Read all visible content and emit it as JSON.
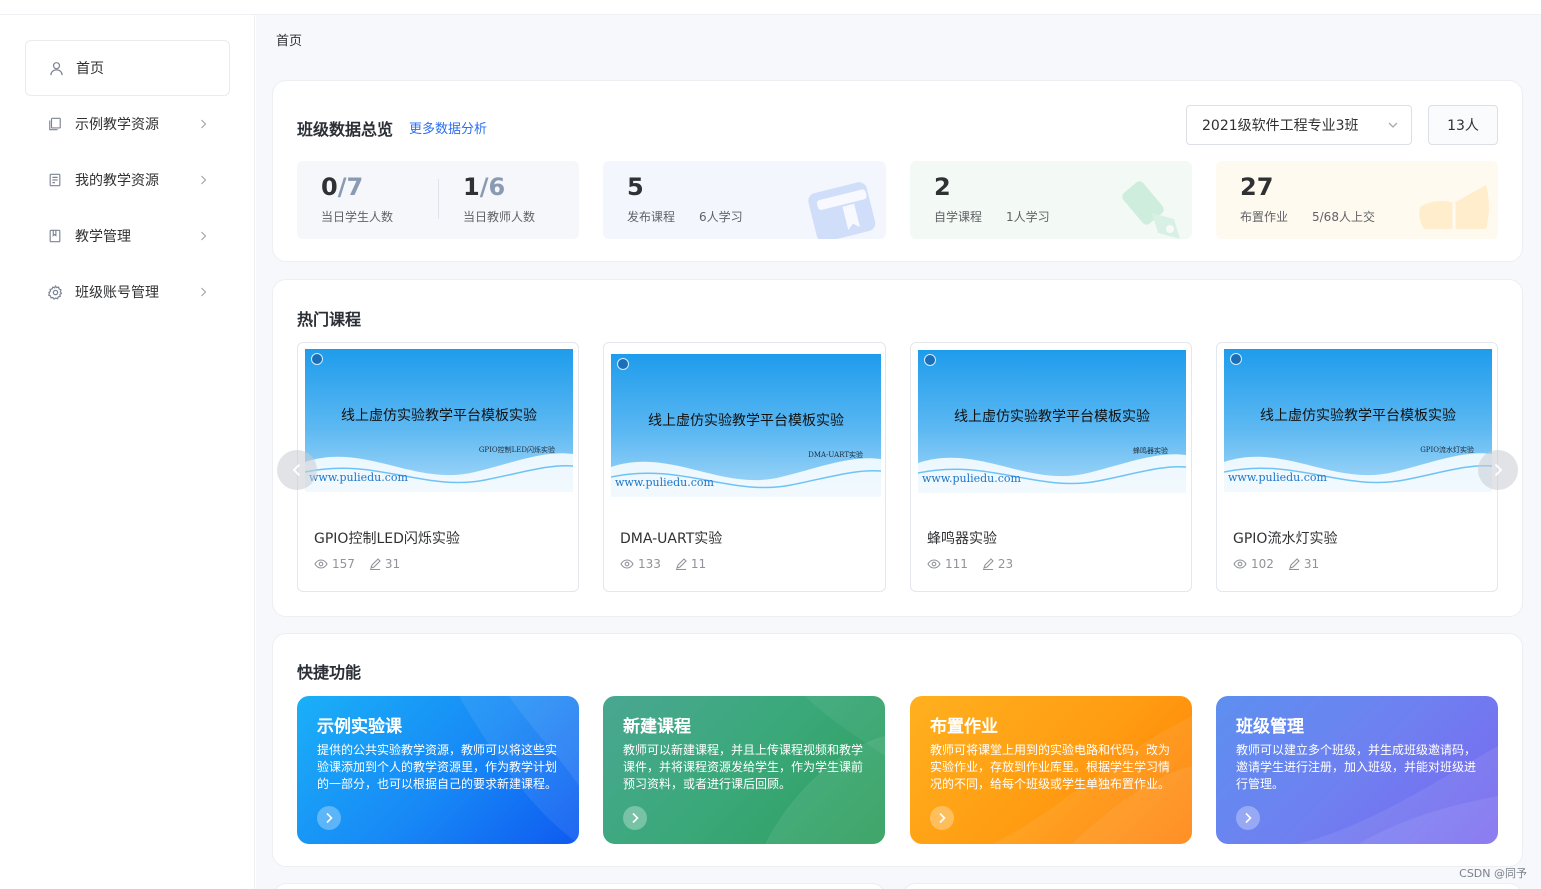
{
  "sidebar": {
    "items": [
      {
        "label": "首页",
        "icon": "user-icon",
        "active": true
      },
      {
        "label": "示例教学资源",
        "icon": "copy-icon"
      },
      {
        "label": "我的教学资源",
        "icon": "document-icon"
      },
      {
        "label": "教学管理",
        "icon": "book-icon"
      },
      {
        "label": "班级账号管理",
        "icon": "gear-icon"
      }
    ]
  },
  "breadcrumb": "首页",
  "overview": {
    "title": "班级数据总览",
    "more_link": "更多数据分析",
    "class_select": "2021级软件工程专业3班",
    "count": "13人",
    "student_present": "0",
    "student_total": "/7",
    "student_label": "当日学生人数",
    "teacher_present": "1",
    "teacher_total": "/6",
    "teacher_label": "当日教师人数",
    "published": {
      "value": "5",
      "label": "发布课程",
      "extra": "6人学习"
    },
    "self_study": {
      "value": "2",
      "label": "自学课程",
      "extra": "1人学习"
    },
    "homework": {
      "value": "27",
      "label": "布置作业",
      "extra": "5/68人上交"
    }
  },
  "hot": {
    "title": "热门课程",
    "thumb_title": "线上虚仿实验教学平台模板实验",
    "thumb_url": "www.puliedu.com",
    "courses": [
      {
        "name": "GPIO控制LED闪烁实验",
        "views": "157",
        "edits": "31",
        "subtitle": "GPIO控制LED闪烁实验"
      },
      {
        "name": "DMA-UART实验",
        "views": "133",
        "edits": "11",
        "subtitle": "DMA-UART实验"
      },
      {
        "name": "蜂鸣器实验",
        "views": "111",
        "edits": "23",
        "subtitle": "蜂鸣器实验"
      },
      {
        "name": "GPIO流水灯实验",
        "views": "102",
        "edits": "31",
        "subtitle": "GPIO流水灯实验"
      }
    ]
  },
  "quick": {
    "title": "快捷功能",
    "items": [
      {
        "title": "示例实验课",
        "desc": "提供的公共实验教学资源，教师可以将这些实验课添加到个人的教学资源里，作为教学计划的一部分，也可以根据自己的要求新建课程。"
      },
      {
        "title": "新建课程",
        "desc": "教师可以新建课程，并且上传课程视频和教学课件，并将课程资源发给学生，作为学生课前预习资料，或者进行课后回顾。"
      },
      {
        "title": "布置作业",
        "desc": "教师可将课堂上用到的实验电路和代码，改为实验作业，存放到作业库里。根据学生学习情况的不同，给每个班级或学生单独布置作业。"
      },
      {
        "title": "班级管理",
        "desc": "教师可以建立多个班级，并生成班级邀请码，邀请学生进行注册，加入班级，并能对班级进行管理。"
      }
    ]
  },
  "watermark": "CSDN @同予",
  "colors": {
    "accent": "#2d6ff0",
    "quick_blue": "#1a8cf5",
    "quick_green": "#35a56e",
    "quick_orange": "#ff9811",
    "quick_purple": "#7a74f0"
  }
}
